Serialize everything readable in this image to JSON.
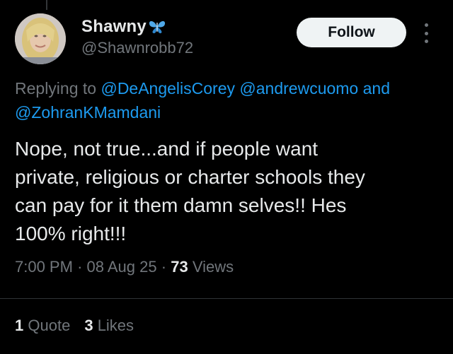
{
  "author": {
    "name": "Shawny",
    "badge_icon": "butterfly-icon",
    "handle": "@Shawnrobb72"
  },
  "follow_label": "Follow",
  "more_icon": "more-vertical-icon",
  "reply_context": {
    "prefix": "Replying to",
    "mention_1": "@DeAngelisCorey",
    "mention_2": "@andrewcuomo",
    "joiner": "and",
    "mention_3": "@ZohranKMamdani"
  },
  "tweet": {
    "lines": [
      "Nope, not true...and if people want",
      "private, religious or charter schools they",
      "can pay for it them damn selves!! Hes",
      "100% right!!!"
    ]
  },
  "meta": {
    "time": "7:00 PM",
    "separator": "·",
    "date": "08 Aug 25",
    "views_count": "73",
    "views_label": "Views"
  },
  "stats": {
    "quotes_count": "1",
    "quotes_label": "Quote",
    "likes_count": "3",
    "likes_label": "Likes"
  },
  "colors": {
    "background": "#000000",
    "text_primary": "#e7e9ea",
    "text_secondary": "#71767b",
    "link": "#1d9bf0",
    "follow_bg": "#eff3f4"
  }
}
